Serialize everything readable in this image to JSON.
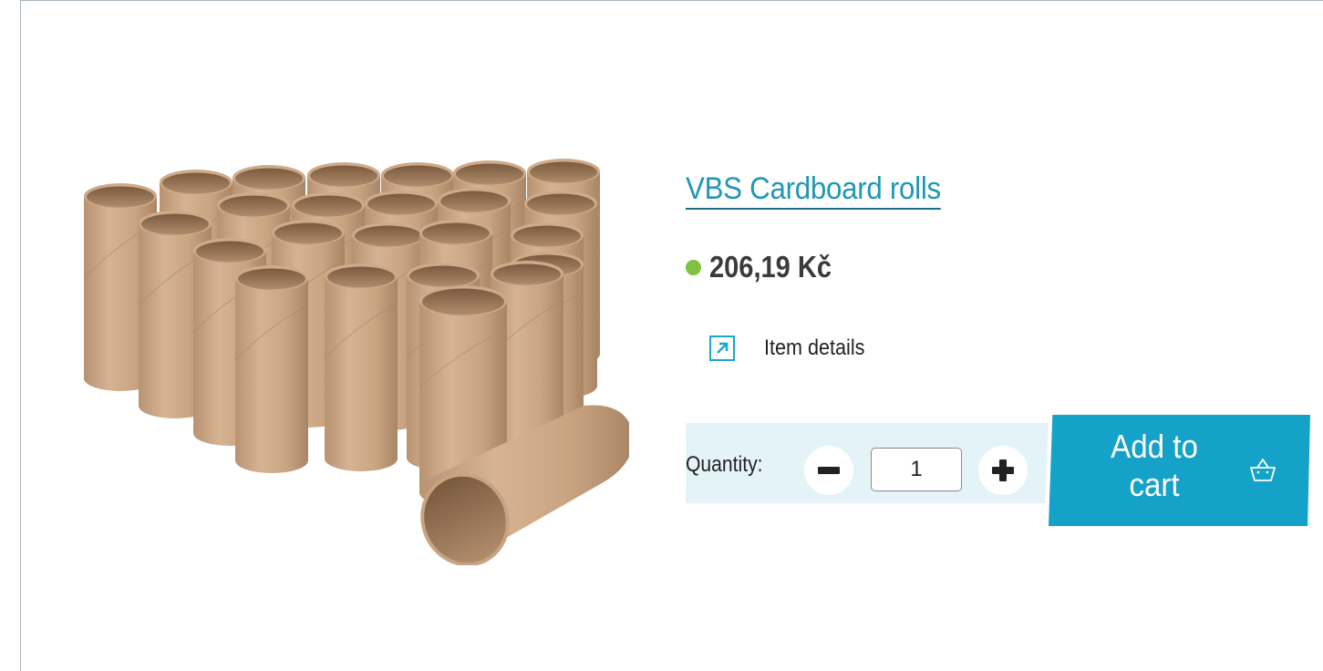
{
  "product": {
    "title": "VBS Cardboard rolls",
    "price": "206,19 Kč",
    "availability_color": "#7fc241",
    "details_label": "Item details",
    "details_icon": "external-arrow-icon",
    "image_icon": "cardboard-rolls-photo"
  },
  "quantity": {
    "label": "Quantity:",
    "value": "1",
    "decrement_icon": "minus-icon",
    "increment_icon": "plus-icon"
  },
  "cart": {
    "label": "Add to cart",
    "icon": "basket-icon",
    "color": "#15a2c9"
  },
  "colors": {
    "accent": "#1e98b4",
    "quantity_band": "#e4f3f8"
  }
}
